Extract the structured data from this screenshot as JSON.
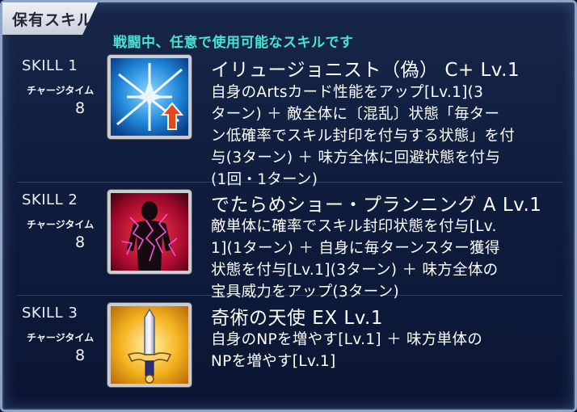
{
  "header": {
    "tab_label": "保有スキル",
    "subtitle": "戦闘中、任意で使用可能なスキルです"
  },
  "skills": [
    {
      "label": "SKILL 1",
      "charge_label": "チャージタイム",
      "charge_value": "8",
      "name": "イリュージョニスト（偽） C+ Lv.1",
      "description_lines": [
        "自身のArtsカード性能をアップ[Lv.1](3",
        "ターン) ＋ 敵全体に〔混乱〕状態「毎ター",
        "ン低確率でスキル封印を付与する状態」を付",
        "与(3ターン) ＋ 味方全体に回避状態を付与",
        "(1回・1ターン)"
      ],
      "icon": "arts-buff-icon",
      "icon_colors": {
        "bg": "#1a7fd6",
        "accent": "#e24a1e"
      }
    },
    {
      "label": "SKILL 2",
      "charge_label": "チャージタイム",
      "charge_value": "8",
      "name": "でたらめショー・プランニング A Lv.1",
      "description_lines": [
        "敵単体に確率でスキル封印状態を付与[Lv.",
        "1](1ターン) ＋ 自身に毎ターンスター獲得",
        "状態を付与[Lv.1](3ターン) ＋ 味方全体の",
        "宝具威力をアップ(3ターン)"
      ],
      "icon": "skill-seal-icon",
      "icon_colors": {
        "bg": "#c4123a",
        "accent": "#ff3fd8"
      }
    },
    {
      "label": "SKILL 3",
      "charge_label": "チャージタイム",
      "charge_value": "8",
      "name": "奇術の天使 EX Lv.1",
      "description_lines": [
        "自身のNPを増やす[Lv.1] ＋ 味方単体の",
        "NPを増やす[Lv.1]"
      ],
      "icon": "np-charge-sword-icon",
      "icon_colors": {
        "bg": "#f0a11a",
        "accent": "#2a2f7a"
      }
    }
  ]
}
